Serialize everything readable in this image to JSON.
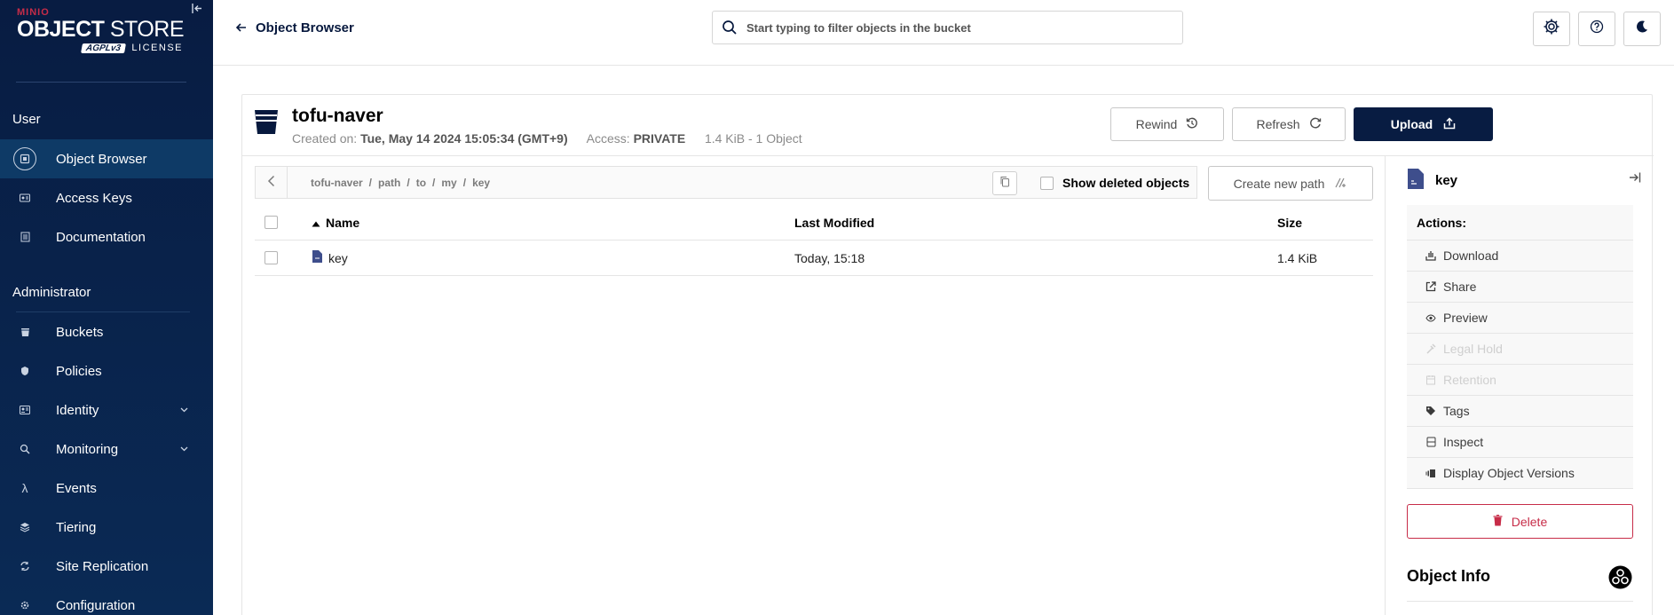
{
  "brand": {
    "minio": "MINIO",
    "object": "OBJECT",
    "store": "STORE",
    "agpl": "AGPLv3",
    "license": "LICENSE"
  },
  "sidebar": {
    "user_section": "User",
    "admin_section": "Administrator",
    "user_items": [
      {
        "label": "Object Browser",
        "icon": "object-browser-icon",
        "active": true
      },
      {
        "label": "Access Keys",
        "icon": "access-keys-icon"
      },
      {
        "label": "Documentation",
        "icon": "documentation-icon"
      }
    ],
    "admin_items": [
      {
        "label": "Buckets",
        "icon": "bucket-icon"
      },
      {
        "label": "Policies",
        "icon": "policy-icon"
      },
      {
        "label": "Identity",
        "icon": "identity-icon",
        "expandable": true
      },
      {
        "label": "Monitoring",
        "icon": "monitoring-icon",
        "expandable": true
      },
      {
        "label": "Events",
        "icon": "lambda-icon"
      },
      {
        "label": "Tiering",
        "icon": "tiering-icon"
      },
      {
        "label": "Site Replication",
        "icon": "site-replication-icon"
      },
      {
        "label": "Configuration",
        "icon": "configuration-icon"
      }
    ]
  },
  "topbar": {
    "back_label": "Object Browser",
    "search_placeholder": "Start typing to filter objects in the bucket"
  },
  "bucket": {
    "name": "tofu-naver",
    "created_label": "Created on:",
    "created_value": "Tue, May 14 2024 15:05:34 (GMT+9)",
    "access_label": "Access:",
    "access_value": "PRIVATE",
    "usage": "1.4 KiB - 1 Object"
  },
  "buttons": {
    "rewind": "Rewind",
    "refresh": "Refresh",
    "upload": "Upload",
    "create_path": "Create new path",
    "delete": "Delete"
  },
  "breadcrumb": [
    "tofu-naver",
    "path",
    "to",
    "my",
    "key"
  ],
  "show_deleted_label": "Show deleted objects",
  "table": {
    "headers": {
      "name": "Name",
      "modified": "Last Modified",
      "size": "Size"
    },
    "rows": [
      {
        "name": "key",
        "modified": "Today, 15:18",
        "size": "1.4 KiB"
      }
    ]
  },
  "panel": {
    "file_name": "key",
    "actions_title": "Actions:",
    "actions": [
      {
        "label": "Download",
        "icon": "download-icon",
        "enabled": true
      },
      {
        "label": "Share",
        "icon": "share-icon",
        "enabled": true
      },
      {
        "label": "Preview",
        "icon": "preview-icon",
        "enabled": true
      },
      {
        "label": "Legal Hold",
        "icon": "legal-hold-icon",
        "enabled": false
      },
      {
        "label": "Retention",
        "icon": "retention-icon",
        "enabled": false
      },
      {
        "label": "Tags",
        "icon": "tag-icon",
        "enabled": true
      },
      {
        "label": "Inspect",
        "icon": "inspect-icon",
        "enabled": true
      },
      {
        "label": "Display Object Versions",
        "icon": "versions-icon",
        "enabled": true
      }
    ],
    "object_info_title": "Object Info"
  },
  "colors": {
    "sidebar_bg": "#081c42",
    "accent_dark": "#081c42",
    "danger": "#c72c48"
  }
}
